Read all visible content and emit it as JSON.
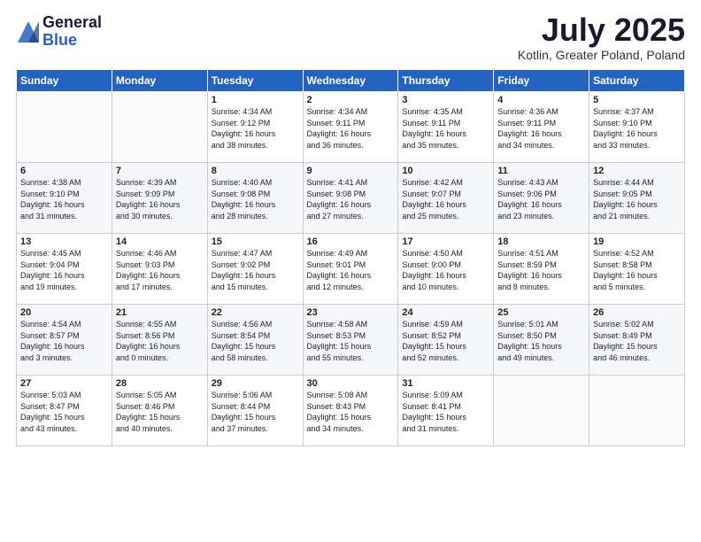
{
  "logo": {
    "general": "General",
    "blue": "Blue"
  },
  "title": "July 2025",
  "location": "Kotlin, Greater Poland, Poland",
  "days_of_week": [
    "Sunday",
    "Monday",
    "Tuesday",
    "Wednesday",
    "Thursday",
    "Friday",
    "Saturday"
  ],
  "weeks": [
    [
      {
        "day": "",
        "info": ""
      },
      {
        "day": "",
        "info": ""
      },
      {
        "day": "1",
        "info": "Sunrise: 4:34 AM\nSunset: 9:12 PM\nDaylight: 16 hours\nand 38 minutes."
      },
      {
        "day": "2",
        "info": "Sunrise: 4:34 AM\nSunset: 9:11 PM\nDaylight: 16 hours\nand 36 minutes."
      },
      {
        "day": "3",
        "info": "Sunrise: 4:35 AM\nSunset: 9:11 PM\nDaylight: 16 hours\nand 35 minutes."
      },
      {
        "day": "4",
        "info": "Sunrise: 4:36 AM\nSunset: 9:11 PM\nDaylight: 16 hours\nand 34 minutes."
      },
      {
        "day": "5",
        "info": "Sunrise: 4:37 AM\nSunset: 9:10 PM\nDaylight: 16 hours\nand 33 minutes."
      }
    ],
    [
      {
        "day": "6",
        "info": "Sunrise: 4:38 AM\nSunset: 9:10 PM\nDaylight: 16 hours\nand 31 minutes."
      },
      {
        "day": "7",
        "info": "Sunrise: 4:39 AM\nSunset: 9:09 PM\nDaylight: 16 hours\nand 30 minutes."
      },
      {
        "day": "8",
        "info": "Sunrise: 4:40 AM\nSunset: 9:08 PM\nDaylight: 16 hours\nand 28 minutes."
      },
      {
        "day": "9",
        "info": "Sunrise: 4:41 AM\nSunset: 9:08 PM\nDaylight: 16 hours\nand 27 minutes."
      },
      {
        "day": "10",
        "info": "Sunrise: 4:42 AM\nSunset: 9:07 PM\nDaylight: 16 hours\nand 25 minutes."
      },
      {
        "day": "11",
        "info": "Sunrise: 4:43 AM\nSunset: 9:06 PM\nDaylight: 16 hours\nand 23 minutes."
      },
      {
        "day": "12",
        "info": "Sunrise: 4:44 AM\nSunset: 9:05 PM\nDaylight: 16 hours\nand 21 minutes."
      }
    ],
    [
      {
        "day": "13",
        "info": "Sunrise: 4:45 AM\nSunset: 9:04 PM\nDaylight: 16 hours\nand 19 minutes."
      },
      {
        "day": "14",
        "info": "Sunrise: 4:46 AM\nSunset: 9:03 PM\nDaylight: 16 hours\nand 17 minutes."
      },
      {
        "day": "15",
        "info": "Sunrise: 4:47 AM\nSunset: 9:02 PM\nDaylight: 16 hours\nand 15 minutes."
      },
      {
        "day": "16",
        "info": "Sunrise: 4:49 AM\nSunset: 9:01 PM\nDaylight: 16 hours\nand 12 minutes."
      },
      {
        "day": "17",
        "info": "Sunrise: 4:50 AM\nSunset: 9:00 PM\nDaylight: 16 hours\nand 10 minutes."
      },
      {
        "day": "18",
        "info": "Sunrise: 4:51 AM\nSunset: 8:59 PM\nDaylight: 16 hours\nand 8 minutes."
      },
      {
        "day": "19",
        "info": "Sunrise: 4:52 AM\nSunset: 8:58 PM\nDaylight: 16 hours\nand 5 minutes."
      }
    ],
    [
      {
        "day": "20",
        "info": "Sunrise: 4:54 AM\nSunset: 8:57 PM\nDaylight: 16 hours\nand 3 minutes."
      },
      {
        "day": "21",
        "info": "Sunrise: 4:55 AM\nSunset: 8:56 PM\nDaylight: 16 hours\nand 0 minutes."
      },
      {
        "day": "22",
        "info": "Sunrise: 4:56 AM\nSunset: 8:54 PM\nDaylight: 15 hours\nand 58 minutes."
      },
      {
        "day": "23",
        "info": "Sunrise: 4:58 AM\nSunset: 8:53 PM\nDaylight: 15 hours\nand 55 minutes."
      },
      {
        "day": "24",
        "info": "Sunrise: 4:59 AM\nSunset: 8:52 PM\nDaylight: 15 hours\nand 52 minutes."
      },
      {
        "day": "25",
        "info": "Sunrise: 5:01 AM\nSunset: 8:50 PM\nDaylight: 15 hours\nand 49 minutes."
      },
      {
        "day": "26",
        "info": "Sunrise: 5:02 AM\nSunset: 8:49 PM\nDaylight: 15 hours\nand 46 minutes."
      }
    ],
    [
      {
        "day": "27",
        "info": "Sunrise: 5:03 AM\nSunset: 8:47 PM\nDaylight: 15 hours\nand 43 minutes."
      },
      {
        "day": "28",
        "info": "Sunrise: 5:05 AM\nSunset: 8:46 PM\nDaylight: 15 hours\nand 40 minutes."
      },
      {
        "day": "29",
        "info": "Sunrise: 5:06 AM\nSunset: 8:44 PM\nDaylight: 15 hours\nand 37 minutes."
      },
      {
        "day": "30",
        "info": "Sunrise: 5:08 AM\nSunset: 8:43 PM\nDaylight: 15 hours\nand 34 minutes."
      },
      {
        "day": "31",
        "info": "Sunrise: 5:09 AM\nSunset: 8:41 PM\nDaylight: 15 hours\nand 31 minutes."
      },
      {
        "day": "",
        "info": ""
      },
      {
        "day": "",
        "info": ""
      }
    ]
  ]
}
